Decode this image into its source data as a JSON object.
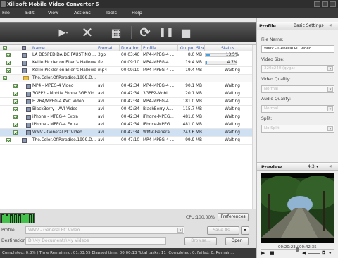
{
  "app": {
    "title": "Xilisoft Mobile Video Converter 6"
  },
  "menu": [
    "File",
    "Edit",
    "View",
    "Actions",
    "Tools",
    "Help"
  ],
  "toolbar": {
    "buttons": [
      {
        "name": "add-video-icon",
        "glyph": "▶"
      },
      {
        "name": "remove-icon",
        "glyph": "✕"
      },
      {
        "name": "clip-icon",
        "glyph": "▦"
      },
      {
        "name": "convert-icon",
        "glyph": "⟳"
      },
      {
        "name": "pause-icon",
        "glyph": "❚❚"
      },
      {
        "name": "stop-icon",
        "glyph": "■"
      }
    ]
  },
  "table": {
    "headers": {
      "name": "Name",
      "format": "Format",
      "duration": "Duration",
      "profile": "Profile",
      "size": "Output Size",
      "status": "Status"
    },
    "rows": [
      {
        "name": "LA DESPEDIDA DE FAUSTINO ...",
        "format": "3gp",
        "duration": "00:03:46",
        "profile": "MP4-MPEG-4 ...",
        "size": "8.0 MB",
        "status": "13.5%",
        "progress": 0.135,
        "type": "file"
      },
      {
        "name": "Kellie Pickler on Ellen's Hallowe...",
        "format": "flv",
        "duration": "00:09:10",
        "profile": "MP4-MPEG-4 ...",
        "size": "19.4 MB",
        "status": "4.7%",
        "progress": 0.047,
        "type": "file"
      },
      {
        "name": "Kellie Pickler on Ellen's Hallowe...",
        "format": "mp4",
        "duration": "00:09:10",
        "profile": "MP4-MPEG-4 ...",
        "size": "19.4 MB",
        "status": "Waiting",
        "type": "file"
      },
      {
        "name": "The.Color.Of.Paradise.1999.D...",
        "format": "",
        "duration": "",
        "profile": "",
        "size": "",
        "status": "",
        "type": "group"
      },
      {
        "name": "MP4 - MPEG-4 Video",
        "format": "avi",
        "duration": "00:42:34",
        "profile": "MP4-MPEG-4 ...",
        "size": "90.1 MB",
        "status": "Waiting",
        "type": "child"
      },
      {
        "name": "3GPP2 - Mobile Phone 3GP Vid...",
        "format": "avi",
        "duration": "00:42:34",
        "profile": "3GPP2-Mobil...",
        "size": "20.1 MB",
        "status": "Waiting",
        "type": "child"
      },
      {
        "name": "H.264/MPEG-4 AVC Video",
        "format": "avi",
        "duration": "00:42:34",
        "profile": "MP4-MPEG-4 ...",
        "size": "181.0 MB",
        "status": "Waiting",
        "type": "child"
      },
      {
        "name": "BlackBerry - AVI Video",
        "format": "avi",
        "duration": "00:42:34",
        "profile": "BlackBerry-A...",
        "size": "115.7 MB",
        "status": "Waiting",
        "type": "child"
      },
      {
        "name": "iPhone - MPEG-4 Extra",
        "format": "avi",
        "duration": "00:42:34",
        "profile": "iPhone-MPEG...",
        "size": "481.0 MB",
        "status": "Waiting",
        "type": "child"
      },
      {
        "name": "iPhone - MPEG-4 Extra",
        "format": "avi",
        "duration": "00:42:34",
        "profile": "iPhone-MPEG...",
        "size": "481.0 MB",
        "status": "Waiting",
        "type": "child"
      },
      {
        "name": "WMV - General PC Video",
        "format": "avi",
        "duration": "00:42:34",
        "profile": "WMV-Genera...",
        "size": "243.6 MB",
        "status": "Waiting",
        "type": "child",
        "selected": true
      },
      {
        "name": "The.Color.Of.Paradise.1999.D...",
        "format": "avi",
        "duration": "00:47:10",
        "profile": "MP4-MPEG-4 ...",
        "size": "99.9 MB",
        "status": "Waiting",
        "type": "file"
      }
    ]
  },
  "bottom": {
    "cpu": "CPU:100.00%",
    "preferences": "Preferences",
    "profile_label": "Profile:",
    "profile_value": "WMV - General PC Video",
    "save_as": "Save As...",
    "destination_label": "Destination:",
    "destination_value": "D:\\My Documents\\My Videos",
    "browse": "Browse...",
    "open": "Open"
  },
  "status": "Completed: 0.3%  |  Time Remaining: 01:03:55  Elapsed time: 00:00:13  Total tasks: 11 ,Completed: 0, Failed: 0, Remain...",
  "right": {
    "profile_tab": "Profile",
    "basic_settings": "Basic Settings",
    "file_name_label": "File Name:",
    "file_name_value": "WMV - General PC Video",
    "video_size_label": "Video Size:",
    "video_size_value": "320x240 (qvga)",
    "video_quality_label": "Video Quality:",
    "video_quality_value": "Normal",
    "audio_quality_label": "Audio Quality:",
    "audio_quality_value": "Normal",
    "split_label": "Split:",
    "split_value": "No Split",
    "preview_label": "Preview",
    "aspect": "4:3",
    "time": "00:20:23 / 00:42:35"
  }
}
